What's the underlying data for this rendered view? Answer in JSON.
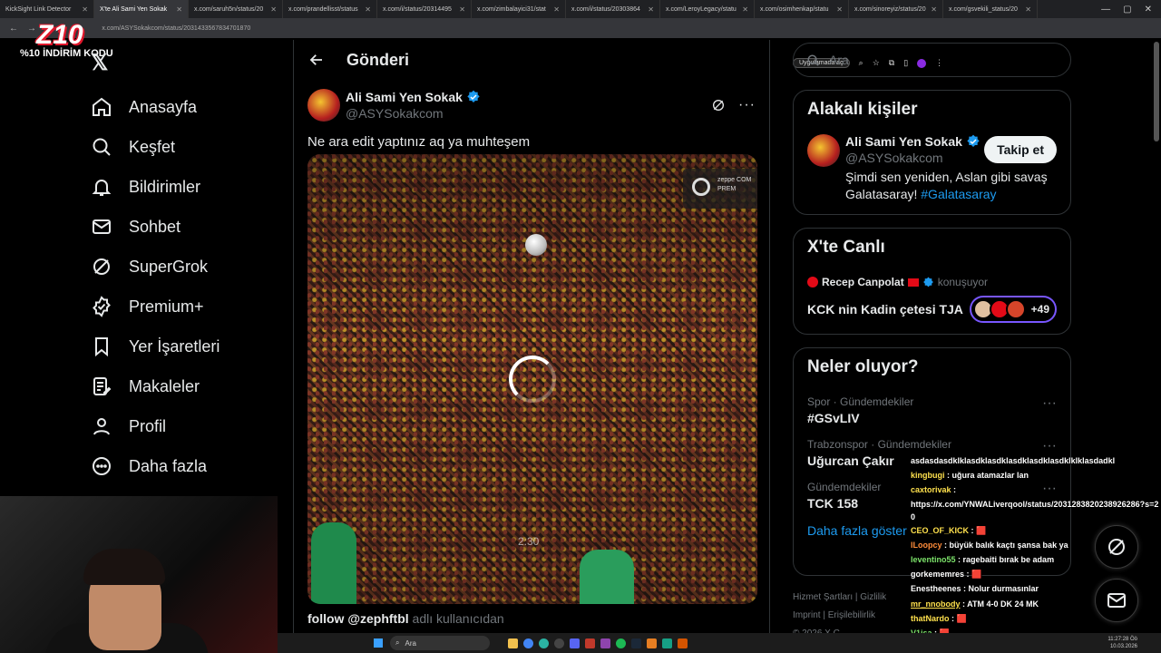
{
  "browser": {
    "tabs": [
      "KickSight Link Detector",
      "X'te Ali Sami Yen Sokak",
      "x.com/saruh5n/status/20",
      "x.com/prandellisst/status",
      "x.com/i/status/20314495",
      "x.com/zimbalayici31/stat",
      "x.com/i/status/20303864",
      "x.com/LeroyLegacy/statu",
      "x.com/osimhenkap/statu",
      "x.com/sinoreyiz/status/20",
      "x.com/gsvekili_status/20"
    ],
    "url": "x.com/ASYSokakcom/status/2031433567834701870",
    "app_pill": "Uygulamada aç"
  },
  "overlay_logo": {
    "big": "Z10",
    "small": "%10 İNDİRİM KODU"
  },
  "sidebar": {
    "items": [
      {
        "label": "Anasayfa",
        "icon": "home-icon"
      },
      {
        "label": "Keşfet",
        "icon": "search-icon"
      },
      {
        "label": "Bildirimler",
        "icon": "bell-icon"
      },
      {
        "label": "Sohbet",
        "icon": "mail-icon"
      },
      {
        "label": "SuperGrok",
        "icon": "grok-icon"
      },
      {
        "label": "Premium+",
        "icon": "verified-icon"
      },
      {
        "label": "Yer İşaretleri",
        "icon": "bookmark-icon"
      },
      {
        "label": "Makaleler",
        "icon": "article-icon"
      },
      {
        "label": "Profil",
        "icon": "person-icon"
      },
      {
        "label": "Daha fazla",
        "icon": "more-circle-icon"
      }
    ]
  },
  "post": {
    "header_title": "Gönderi",
    "author_name": "Ali Sami Yen Sokak",
    "author_handle": "@ASYSokakcom",
    "text": "Ne ara edit yaptınız aq ya muhteşem",
    "watermark_line1": "zeppe COM",
    "watermark_line2": "PREM",
    "video_time": "2:30",
    "follow_prefix": "follow ",
    "follow_handle": "@zephftbl",
    "follow_suffix": " adlı kullanıcıdan"
  },
  "right": {
    "search_placeholder": "Ara",
    "related": {
      "title": "Alakalı kişiler",
      "name": "Ali Sami Yen Sokak",
      "handle": "@ASYSokakcom",
      "follow_button": "Takip et",
      "bio": "Şimdi sen yeniden, Aslan gibi savaş Galatasaray! ",
      "bio_tag": "#Galatasaray"
    },
    "live": {
      "title": "X'te Canlı",
      "speaker": "Recep Canpolat",
      "speaking": "konuşuyor",
      "topic": "KCK nin Kadin çetesi TJA",
      "listeners": "+49"
    },
    "trends": {
      "title": "Neler oluyor?",
      "items": [
        {
          "meta": "Spor · Gündemdekiler",
          "name": "#GSvLIV"
        },
        {
          "meta": "Trabzonspor · Gündemdekiler",
          "name": "Uğurcan Çakır"
        },
        {
          "meta": "Gündemdekiler",
          "name": "TCK 158"
        }
      ],
      "show_more": "Daha fazla göster"
    },
    "footer": {
      "line1": "Hizmet Şartları  |  Gizlilik",
      "line2": "Imprint  |  Erişilebilirlik",
      "line3": "© 2026 X C"
    }
  },
  "chat": [
    {
      "user": "",
      "msg": "asdasdasdklklasdklasdklasdklasdklasdklklklasdadkl"
    },
    {
      "user": "kingbugi",
      "msg": " : uğura atamazlar lan"
    },
    {
      "user": "caxtorivak",
      "msg": " :"
    },
    {
      "user": "",
      "msg": "https://x.com/YNWALiverqool/status/2031283820238926286?s=20"
    },
    {
      "user": "CEO_OF_KICK",
      "msg": " : 🟥"
    },
    {
      "user": "lLoopcy",
      "msg": " : büyük balık kaçtı şansa bak ya"
    },
    {
      "user": "leventino55",
      "msg": " : ragebaiti bırak be adam"
    },
    {
      "user": "gorkememres",
      "msg": " : 🟥"
    },
    {
      "user": "Enestheenes",
      "msg": " : Nolur durmasınlar"
    },
    {
      "user": "mr_nnobody",
      "msg": " : ATM 4-0 DK 24 MK"
    },
    {
      "user": "thatNardo",
      "msg": " : 🟥"
    },
    {
      "user": "V1isa",
      "msg": " : 🟥"
    }
  ],
  "taskbar": {
    "search": "Ara",
    "time": "11:27:28 Öö",
    "date": "10.03.2026"
  },
  "colors": {
    "accent": "#1d9bf0",
    "bg": "#000000",
    "border": "#2f3336",
    "muted": "#71767b",
    "live": "#7856ff"
  }
}
